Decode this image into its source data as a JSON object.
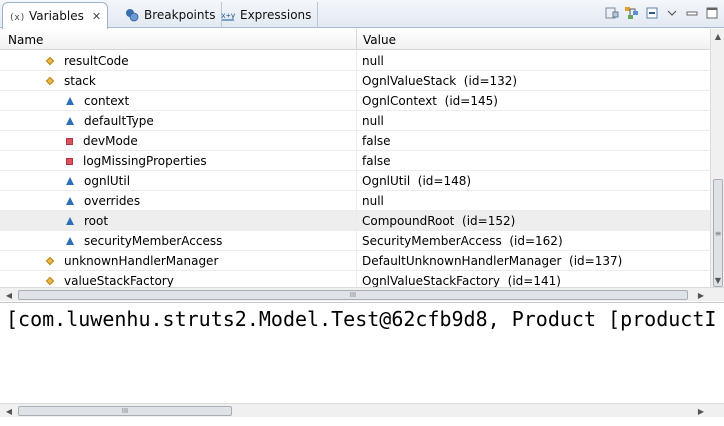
{
  "tabs": [
    {
      "label": "Variables",
      "icon": "variables-icon",
      "active": true
    },
    {
      "label": "Breakpoints",
      "icon": "breakpoints-icon",
      "active": false
    },
    {
      "label": "Expressions",
      "icon": "expressions-icon",
      "active": false
    }
  ],
  "tab_close_glyph": "✕",
  "columns": {
    "name": "Name",
    "value": "Value"
  },
  "rows": [
    {
      "name": "resultCode",
      "value": "null",
      "icon": "field-diamond-icon",
      "indent": 1
    },
    {
      "name": "stack",
      "value": "OgnlValueStack  (id=132)",
      "icon": "field-diamond-icon",
      "indent": 1
    },
    {
      "name": "context",
      "value": "OgnlContext  (id=145)",
      "icon": "protected-triangle-icon",
      "indent": 2
    },
    {
      "name": "defaultType",
      "value": "null",
      "icon": "protected-triangle-icon",
      "indent": 2
    },
    {
      "name": "devMode",
      "value": "false",
      "icon": "private-square-icon",
      "indent": 2
    },
    {
      "name": "logMissingProperties",
      "value": "false",
      "icon": "private-square-icon",
      "indent": 2
    },
    {
      "name": "ognlUtil",
      "value": "OgnlUtil  (id=148)",
      "icon": "protected-triangle-icon",
      "indent": 2
    },
    {
      "name": "overrides",
      "value": "null",
      "icon": "protected-triangle-icon",
      "indent": 2
    },
    {
      "name": "root",
      "value": "CompoundRoot  (id=152)",
      "icon": "protected-triangle-icon",
      "indent": 2,
      "selected": true
    },
    {
      "name": "securityMemberAccess",
      "value": "SecurityMemberAccess  (id=162)",
      "icon": "protected-triangle-icon",
      "indent": 2
    },
    {
      "name": "unknownHandlerManager",
      "value": "DefaultUnknownHandlerManager  (id=137)",
      "icon": "field-diamond-icon",
      "indent": 1
    },
    {
      "name": "valueStackFactory",
      "value": "OgnlValueStackFactory  (id=141)",
      "icon": "field-diamond-icon",
      "indent": 1
    }
  ],
  "detail_text": "[com.luwenhu.struts2.Model.Test@62cfb9d8, Product [productI",
  "colors": {
    "selected_row": "#eeeeee",
    "triangle": "#2d6fb8",
    "square": "#d9525e",
    "diamond": "#e8b64a"
  }
}
